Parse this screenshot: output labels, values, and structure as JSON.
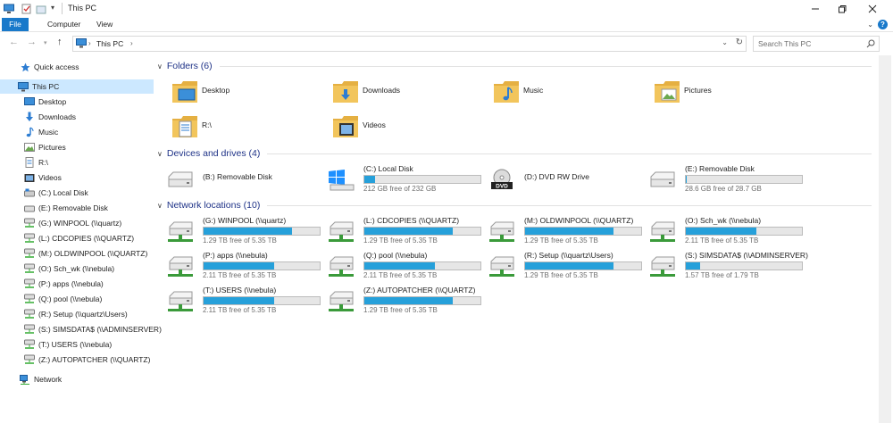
{
  "window": {
    "title": "This PC",
    "controls": [
      "minimize-icon",
      "maximize-icon",
      "close-icon"
    ]
  },
  "ribbon": {
    "tabs": [
      "File",
      "Computer",
      "View"
    ]
  },
  "address_bar": {
    "path": "This PC",
    "separator": "›",
    "search_placeholder": "Search This PC"
  },
  "sidebar": {
    "quick_access": "Quick access",
    "this_pc": "This PC",
    "items": [
      {
        "label": "Desktop",
        "icon": "desktop-icon"
      },
      {
        "label": "Downloads",
        "icon": "download-arrow-icon"
      },
      {
        "label": "Music",
        "icon": "music-note-icon"
      },
      {
        "label": "Pictures",
        "icon": "pictures-icon"
      },
      {
        "label": "R:\\",
        "icon": "document-icon"
      },
      {
        "label": "Videos",
        "icon": "video-icon"
      },
      {
        "label": "(C:) Local Disk",
        "icon": "local-disk-icon"
      },
      {
        "label": "(E:) Removable Disk",
        "icon": "removable-disk-icon"
      },
      {
        "label": "(G:) WINPOOL (\\\\quartz)",
        "icon": "network-drive-icon"
      },
      {
        "label": "(L:) CDCOPIES (\\\\QUARTZ)",
        "icon": "network-drive-icon"
      },
      {
        "label": "(M:) OLDWINPOOL (\\\\QUARTZ)",
        "icon": "network-drive-icon"
      },
      {
        "label": "(O:) Sch_wk (\\\\nebula)",
        "icon": "network-drive-icon"
      },
      {
        "label": "(P:) apps (\\\\nebula)",
        "icon": "network-drive-icon"
      },
      {
        "label": "(Q:) pool (\\\\nebula)",
        "icon": "network-drive-icon"
      },
      {
        "label": "(R:) Setup (\\\\quartz\\Users)",
        "icon": "network-drive-icon"
      },
      {
        "label": "(S:) SIMSDATA$ (\\\\ADMINSERVER)",
        "icon": "network-drive-icon"
      },
      {
        "label": "(T:) USERS (\\\\nebula)",
        "icon": "network-drive-icon"
      },
      {
        "label": "(Z:) AUTOPATCHER (\\\\QUARTZ)",
        "icon": "network-drive-icon"
      }
    ],
    "network": "Network"
  },
  "sections": {
    "folders": "Folders (6)",
    "devices": "Devices and drives (4)",
    "network": "Network locations (10)"
  },
  "folders": [
    {
      "label": "Desktop",
      "icon": "desktop-folder-icon"
    },
    {
      "label": "Downloads",
      "icon": "downloads-folder-icon"
    },
    {
      "label": "Music",
      "icon": "music-folder-icon"
    },
    {
      "label": "Pictures",
      "icon": "pictures-folder-icon"
    },
    {
      "label": "R:\\",
      "icon": "document-folder-icon"
    },
    {
      "label": "Videos",
      "icon": "videos-folder-icon"
    }
  ],
  "devices": [
    {
      "name": "(B:) Removable Disk",
      "icon": "removable-disk-icon",
      "free": "",
      "used_fraction": null
    },
    {
      "name": "(C:) Local Disk",
      "icon": "windows-disk-icon",
      "free": "212 GB free of 232 GB",
      "used_fraction": 0.09
    },
    {
      "name": "(D:) DVD RW Drive",
      "icon": "dvd-drive-icon",
      "free": "",
      "used_fraction": null
    },
    {
      "name": "(E:) Removable Disk",
      "icon": "removable-disk-icon",
      "free": "28.6 GB free of 28.7 GB",
      "used_fraction": 0.01
    }
  ],
  "network_locations": [
    {
      "name": "(G:) WINPOOL (\\\\quartz)",
      "free": "1.29 TB free of 5.35 TB",
      "used_fraction": 0.76
    },
    {
      "name": "(L:) CDCOPIES (\\\\QUARTZ)",
      "free": "1.29 TB free of 5.35 TB",
      "used_fraction": 0.76
    },
    {
      "name": "(M:) OLDWINPOOL (\\\\QUARTZ)",
      "free": "1.29 TB free of 5.35 TB",
      "used_fraction": 0.76
    },
    {
      "name": "(O:) Sch_wk (\\\\nebula)",
      "free": "2.11 TB free of 5.35 TB",
      "used_fraction": 0.61
    },
    {
      "name": "(P:) apps (\\\\nebula)",
      "free": "2.11 TB free of 5.35 TB",
      "used_fraction": 0.61
    },
    {
      "name": "(Q:) pool (\\\\nebula)",
      "free": "2.11 TB free of 5.35 TB",
      "used_fraction": 0.61
    },
    {
      "name": "(R:) Setup (\\\\quartz\\Users)",
      "free": "1.29 TB free of 5.35 TB",
      "used_fraction": 0.76
    },
    {
      "name": "(S:) SIMSDATA$ (\\\\ADMINSERVER)",
      "free": "1.57 TB free of 1.79 TB",
      "used_fraction": 0.12
    },
    {
      "name": "(T:) USERS (\\\\nebula)",
      "free": "2.11 TB free of 5.35 TB",
      "used_fraction": 0.61
    },
    {
      "name": "(Z:) AUTOPATCHER (\\\\QUARTZ)",
      "free": "1.29 TB free of 5.35 TB",
      "used_fraction": 0.76
    }
  ],
  "colors": {
    "accent": "#1979ca",
    "bar_fill": "#26a0da",
    "section_header": "#1e3287",
    "selected": "#cce8ff",
    "folder": "#f2c55c"
  }
}
